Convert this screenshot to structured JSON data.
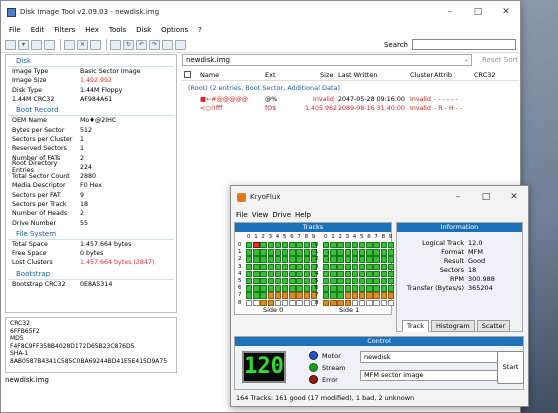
{
  "main_window": {
    "title": "Disk Image Tool v2.09.03 - newdisk.img",
    "menu": [
      "File",
      "Edit",
      "Filters",
      "Hex",
      "Tools",
      "Disk",
      "Options",
      "?"
    ],
    "search_label": "Search",
    "status": "newdisk.img"
  },
  "disk": {
    "header": "Disk",
    "rows": [
      {
        "k": "Image Type",
        "v": "Basic Sector Image",
        "red": false
      },
      {
        "k": "Image Size",
        "v": "1.492.992",
        "red": true
      },
      {
        "k": "Disk Type",
        "v": "1.44M Floppy",
        "red": false
      },
      {
        "k": "1.44M CRC32",
        "v": "AF984A61",
        "red": false
      }
    ]
  },
  "boot_record": {
    "header": "Boot Record",
    "rows": [
      {
        "k": "OEM Name",
        "v": "Mo♦@2IHC",
        "red": false
      },
      {
        "k": "Bytes per Sector",
        "v": "512",
        "red": false
      },
      {
        "k": "Sectors per Cluster",
        "v": "1",
        "red": false
      },
      {
        "k": "Reserved Sectors",
        "v": "1",
        "red": false
      },
      {
        "k": "Number of FATs",
        "v": "2",
        "red": false
      },
      {
        "k": "Root Directory Entries",
        "v": "224",
        "red": false
      },
      {
        "k": "Total Sector Count",
        "v": "2880",
        "red": false
      },
      {
        "k": "Media Descriptor",
        "v": "F0 Hex",
        "red": false
      },
      {
        "k": "Sectors per FAT",
        "v": "9",
        "red": false
      },
      {
        "k": "Sectors per Track",
        "v": "18",
        "red": false
      },
      {
        "k": "Number of Heads",
        "v": "2",
        "red": false
      },
      {
        "k": "Drive Number",
        "v": "55",
        "red": false
      }
    ]
  },
  "file_system": {
    "header": "File System",
    "rows": [
      {
        "k": "Total Space",
        "v": "1.457.664 bytes",
        "red": false
      },
      {
        "k": "Free Space",
        "v": "0 bytes",
        "red": false
      },
      {
        "k": "Lost Clusters",
        "v": "1.457.664 bytes  (2847)",
        "red": true
      }
    ]
  },
  "bootstrap": {
    "header": "Bootstrap",
    "rows": [
      {
        "k": "Bootstrap CRC32",
        "v": "0E8A5314",
        "red": false
      }
    ]
  },
  "hashes": {
    "crc32_label": "CRC32",
    "crc32": "6FFB65F2",
    "md5_label": "MD5",
    "md5": "F4F8C9FF358B4028D172D65B23C876D5",
    "sha1_label": "SHA-1",
    "sha1": "8AB0587B4341C585C0BA69244BD41E5E415D9A75"
  },
  "file_list": {
    "path": "newdisk.img",
    "reset_sort": "Reset Sort",
    "columns": [
      "Name",
      "Ext",
      "Size",
      "Last Written",
      "Cluster",
      "Attrib",
      "CRC32"
    ],
    "root_row": "(Root)  (2 entries, Boot Sector, Additional Data)",
    "rows": [
      {
        "name": "■←#@@@@@",
        "ext": "@%",
        "size": "Invalid",
        "date": "2047-05-28  09:16:00",
        "cluster": "Invalid",
        "attrib": "- - - - - -"
      },
      {
        "name": "<○!!fff",
        "ext": "fO$",
        "size": "1.405.962",
        "date": "2089-08-16  31:40:00",
        "cluster": "Invalid",
        "attrib": "- R - H - -"
      }
    ]
  },
  "kryoflux": {
    "title": "KryoFlux",
    "menu": [
      "File",
      "View",
      "Drive",
      "Help"
    ],
    "tracks_header": "Tracks",
    "info_header": "Information",
    "col_header": "0123456789",
    "row_labels": [
      "0",
      "1",
      "2",
      "3",
      "4",
      "5",
      "6",
      "7",
      "8"
    ],
    "side0": "Side 0",
    "side1": "Side 1",
    "info": [
      {
        "k": "Logical Track",
        "v": "12.0"
      },
      {
        "k": "Format",
        "v": "MFM"
      },
      {
        "k": "Result",
        "v": "Good"
      },
      {
        "k": "Sectors",
        "v": "18"
      },
      {
        "k": "RPM",
        "v": "300.988"
      },
      {
        "k": "Transfer (Bytes/s)",
        "v": "365204"
      }
    ],
    "tabs": [
      "Track",
      "Histogram",
      "Scatter"
    ],
    "control_header": "Control",
    "lcd": "120",
    "motor": "Motor",
    "stream": "Stream",
    "error": "Error",
    "disk_name": "newdisk",
    "format": "MFM sector image",
    "start": "Start",
    "status": "164 Tracks: 161 good (17 modified), 1 bad, 2 unknown",
    "colors": {
      "good": "#34c234",
      "modified": "#e08a2c",
      "bad": "#e23030",
      "led_motor": "#2a4fd6",
      "led_stream": "#1d9a1d",
      "led_error": "#9a1616"
    }
  }
}
